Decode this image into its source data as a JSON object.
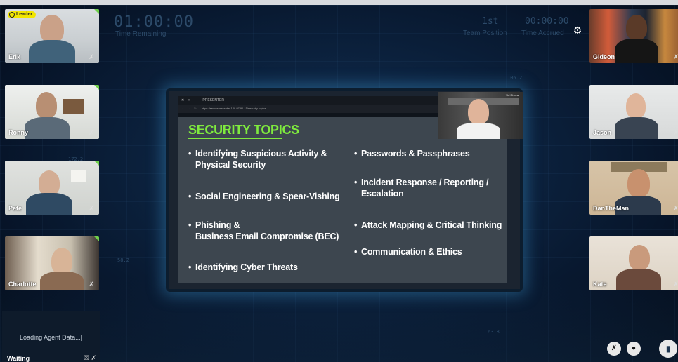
{
  "hud": {
    "time_remaining_value": "01:00:00",
    "time_remaining_label": "Time Remaining",
    "team_position_value": "1st",
    "team_position_label": "Team Position",
    "time_accrued_value": "00:00:00",
    "time_accrued_label": "Time Accrued",
    "markers": [
      "106.2",
      "172.2",
      "58.2",
      "63.8"
    ]
  },
  "leader_badge": "Leader",
  "participants_left": [
    {
      "name": "Erik"
    },
    {
      "name": "Ronny"
    },
    {
      "name": "Pete"
    },
    {
      "name": "Charlotte"
    }
  ],
  "participants_right": [
    {
      "name": "Gideon"
    },
    {
      "name": "Jason"
    },
    {
      "name": "DanTheMan"
    },
    {
      "name": "Kate"
    }
  ],
  "waiting_tile": {
    "status": "Loading Agent Data...|",
    "name": "Waiting"
  },
  "presenter_window": {
    "title": "PRESENTER",
    "url": "https://securepresenter.128.97.91.15/security-topics",
    "pip_name": "Val Rivera"
  },
  "slide": {
    "title": "SECURITY TOPICS",
    "left_bullets": [
      [
        "Identifying Suspicious Activity &",
        "Physical Security"
      ],
      [
        "Social Engineering & Spear-Vishing"
      ],
      [
        "Phishing &",
        "Business Email Compromise (BEC)"
      ],
      [
        "Identifying Cyber Threats"
      ]
    ],
    "right_bullets": [
      [
        "Passwords & Passphrases"
      ],
      [
        "Incident Response / Reporting /",
        "Escalation"
      ],
      [
        "Attack Mapping & Critical Thinking"
      ],
      [
        "Communication & Ethics"
      ]
    ]
  },
  "icons": {
    "mute": "mic-off-icon",
    "settings": "gear-icon",
    "camera": "camera-icon",
    "chat": "chat-icon"
  },
  "colors": {
    "slide_title": "#7fea3e",
    "leader_badge": "#f2e600",
    "tile_corner": "#6fd04a"
  }
}
